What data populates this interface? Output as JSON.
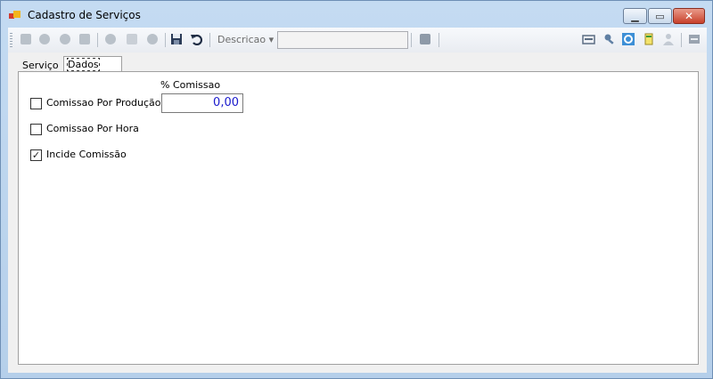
{
  "window": {
    "title": "Cadastro de Serviços",
    "controls": {
      "minimize": "▭",
      "maximize": "▭",
      "close": "✕"
    }
  },
  "toolbar": {
    "descricao_label": "Descricao ▾",
    "search_value": ""
  },
  "tabs": [
    {
      "label": "Serviço",
      "active": false
    },
    {
      "label": "Dados Adicionais",
      "active": true
    }
  ],
  "form": {
    "comissao_producao": {
      "label": "Comissao Por Produção",
      "checked": false
    },
    "comissao_hora": {
      "label": "Comissao Por Hora",
      "checked": false
    },
    "incide_comissao": {
      "label": "Incide Comissão",
      "checked": true,
      "mark": "✓"
    },
    "percent_label": "% Comissao",
    "percent_value": "0,00"
  },
  "colors": {
    "accent": "#1a1acc",
    "close": "#c8412c"
  }
}
